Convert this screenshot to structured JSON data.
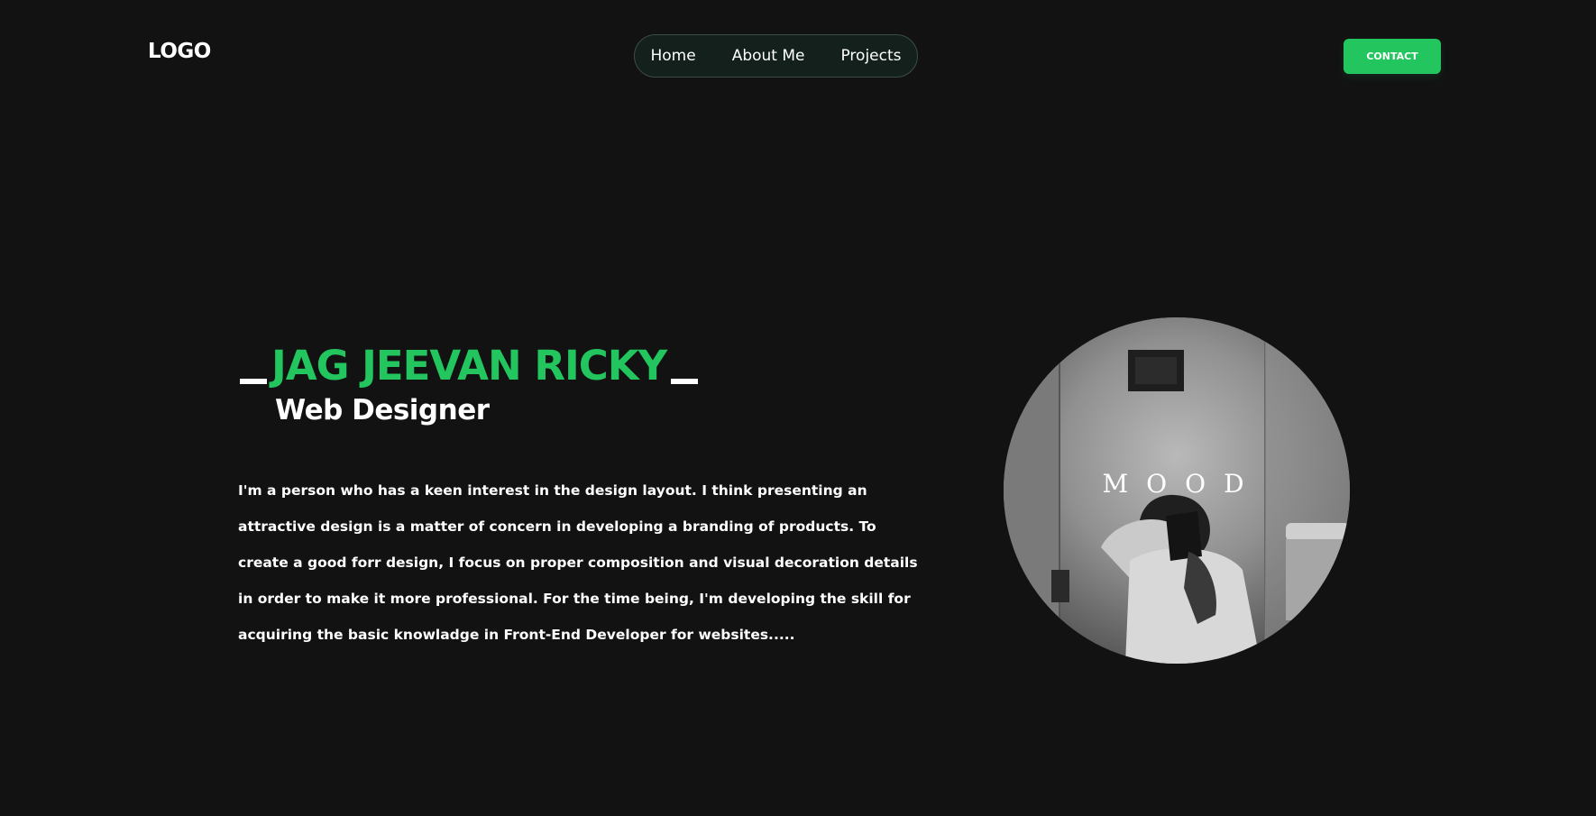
{
  "header": {
    "logo": "LOGO",
    "nav": [
      "Home",
      "About Me",
      "Projects"
    ],
    "contact_label": "CONTACT"
  },
  "hero": {
    "name": "JAG JEEVAN RICKY",
    "role": "Web Designer",
    "bio": "I'm a person who has a keen interest in the design layout. I think presenting an attractive design is a matter of concern in developing a branding of products. To create a good forr design, I focus on proper composition and visual decoration details in order to make it more professional. For the time being, I'm developing the skill for acquiring the basic knowladge in Front-End Developer for websites.....",
    "photo_overlay_text": "MOOD"
  },
  "colors": {
    "background": "#121212",
    "accent": "#22c55e",
    "text": "#ffffff"
  }
}
